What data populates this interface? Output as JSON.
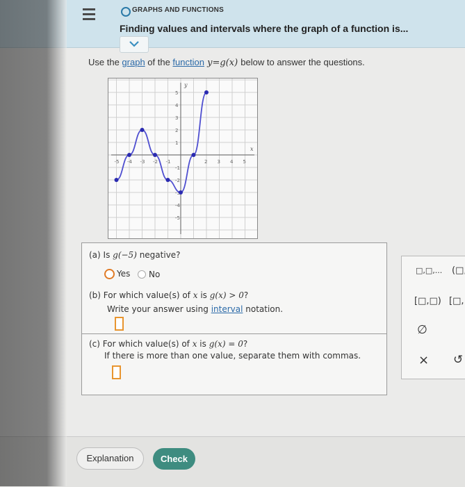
{
  "header": {
    "topic": "GRAPHS AND FUNCTIONS",
    "title": "Finding values and intervals where the graph of a function is..."
  },
  "prompt": {
    "before": "Use the ",
    "graph_link": "graph",
    "middle": " of the ",
    "function_link": "function",
    "equation": " y=g(x) ",
    "after": "below to answer the questions."
  },
  "graph": {
    "axis_x_label": "x",
    "axis_y_label": "y",
    "x_ticks": [
      "-5",
      "-4",
      "-3",
      "-2",
      "-1",
      "2",
      "3",
      "4",
      "5"
    ],
    "y_ticks": [
      "5",
      "4",
      "3",
      "2",
      "1",
      "-1",
      "-2",
      "-3",
      "-4",
      "-5"
    ],
    "points": [
      [
        -5,
        -2
      ],
      [
        -4,
        0
      ],
      [
        -3,
        2
      ],
      [
        -2,
        0
      ],
      [
        -1,
        -2
      ],
      [
        0,
        -3
      ],
      [
        1,
        0
      ],
      [
        2,
        5
      ]
    ]
  },
  "questions": {
    "a": {
      "label": "(a) Is ",
      "expr": "g(−5)",
      "suffix": " negative?",
      "yes": "Yes",
      "no": "No"
    },
    "b": {
      "label": "(b) For which value(s) of ",
      "var": "x",
      "is": " is ",
      "expr": "g(x) > 0",
      "suffix": "?",
      "line2_before": "Write your answer using ",
      "line2_link": "interval",
      "line2_after": " notation."
    },
    "c": {
      "label": "(c) For which value(s) of ",
      "var": "x",
      "is": " is ",
      "expr": "g(x) = 0",
      "suffix": "?",
      "line2": "If there is more than one value, separate them with commas."
    }
  },
  "palette": {
    "item1": "□,□,...",
    "item2": "(□,",
    "item3": "[□,□)",
    "item4": "[□,",
    "empty_set": "∅",
    "clear": "×",
    "undo": "↺"
  },
  "footer": {
    "explanation": "Explanation",
    "check": "Check"
  },
  "colors": {
    "accent": "#e07b26",
    "check_button": "#3e8c80",
    "link": "#2b6aa8",
    "curve": "#4f4fd0"
  }
}
